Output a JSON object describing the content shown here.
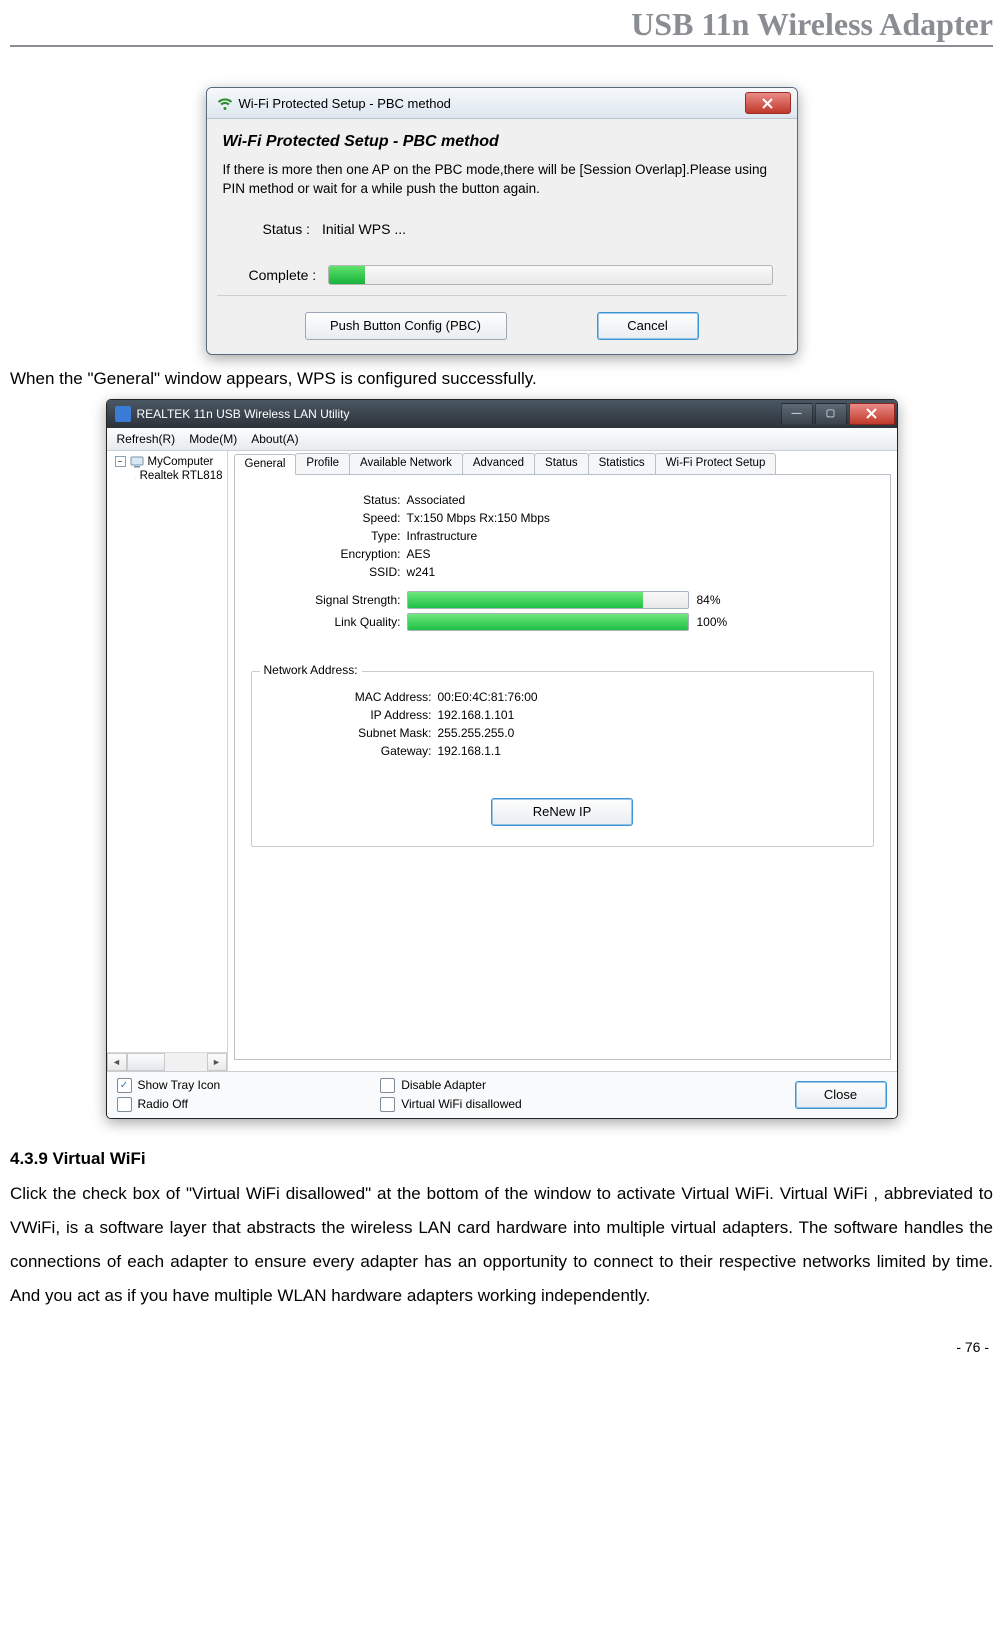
{
  "page": {
    "header": "USB 11n Wireless Adapter",
    "number": "- 76 -"
  },
  "wps_dialog": {
    "title": "Wi-Fi Protected Setup - PBC method",
    "heading": "Wi-Fi Protected Setup - PBC method",
    "info": "If there is more then one AP on the PBC mode,there will be [Session Overlap].Please using PIN method or wait for a while push the button again.",
    "status_label": "Status : ",
    "status_value": "Initial WPS ...",
    "complete_label": "Complete :",
    "progress_percent": 8,
    "pbc_button": "Push Button Config (PBC)",
    "cancel_button": "Cancel"
  },
  "caption1": "When the \"General\" window appears, WPS is configured successfully.",
  "appwin": {
    "title": "REALTEK 11n USB Wireless LAN Utility",
    "menu": {
      "refresh": "Refresh(R)",
      "mode": "Mode(M)",
      "about": "About(A)"
    },
    "tree": {
      "root": "MyComputer",
      "child": "Realtek RTL818"
    },
    "tabs": {
      "general": "General",
      "profile": "Profile",
      "available": "Available Network",
      "advanced": "Advanced",
      "status": "Status",
      "statistics": "Statistics",
      "wps": "Wi-Fi Protect Setup"
    },
    "general": {
      "status_label": "Status:",
      "status_value": "Associated",
      "speed_label": "Speed:",
      "speed_value": "Tx:150 Mbps Rx:150 Mbps",
      "type_label": "Type:",
      "type_value": "Infrastructure",
      "encryption_label": "Encryption:",
      "encryption_value": "AES",
      "ssid_label": "SSID:",
      "ssid_value": "w241",
      "signal_label": "Signal Strength:",
      "signal_percent": 84,
      "signal_text": "84%",
      "link_label": "Link Quality:",
      "link_percent": 100,
      "link_text": "100%"
    },
    "netaddr": {
      "legend": "Network Address:",
      "mac_label": "MAC Address:",
      "mac_value": "00:E0:4C:81:76:00",
      "ip_label": "IP Address:",
      "ip_value": "192.168.1.101",
      "subnet_label": "Subnet Mask:",
      "subnet_value": "255.255.255.0",
      "gateway_label": "Gateway:",
      "gateway_value": "192.168.1.1",
      "renew_button": "ReNew IP"
    },
    "footer": {
      "show_tray": "Show Tray Icon",
      "radio_off": "Radio Off",
      "disable_adapter": "Disable Adapter",
      "vwifi_disallowed": "Virtual WiFi disallowed",
      "close_button": "Close"
    }
  },
  "section": {
    "heading": "4.3.9   Virtual WiFi",
    "body": "Click the check box of \"Virtual WiFi disallowed\" at the bottom of the window to activate Virtual WiFi. Virtual WiFi , abbreviated to VWiFi, is a software layer that abstracts the wireless LAN card hardware into multiple virtual adapters. The software handles the connections of each adapter to ensure every adapter has an opportunity to connect to their respective networks limited by time. And you act as if you have multiple WLAN hardware adapters working independently."
  },
  "chart_data": {
    "type": "bar",
    "title": "General tab meters",
    "series": [
      {
        "name": "Signal Strength",
        "value": 84,
        "unit": "%"
      },
      {
        "name": "Link Quality",
        "value": 100,
        "unit": "%"
      }
    ],
    "range": [
      0,
      100
    ]
  }
}
